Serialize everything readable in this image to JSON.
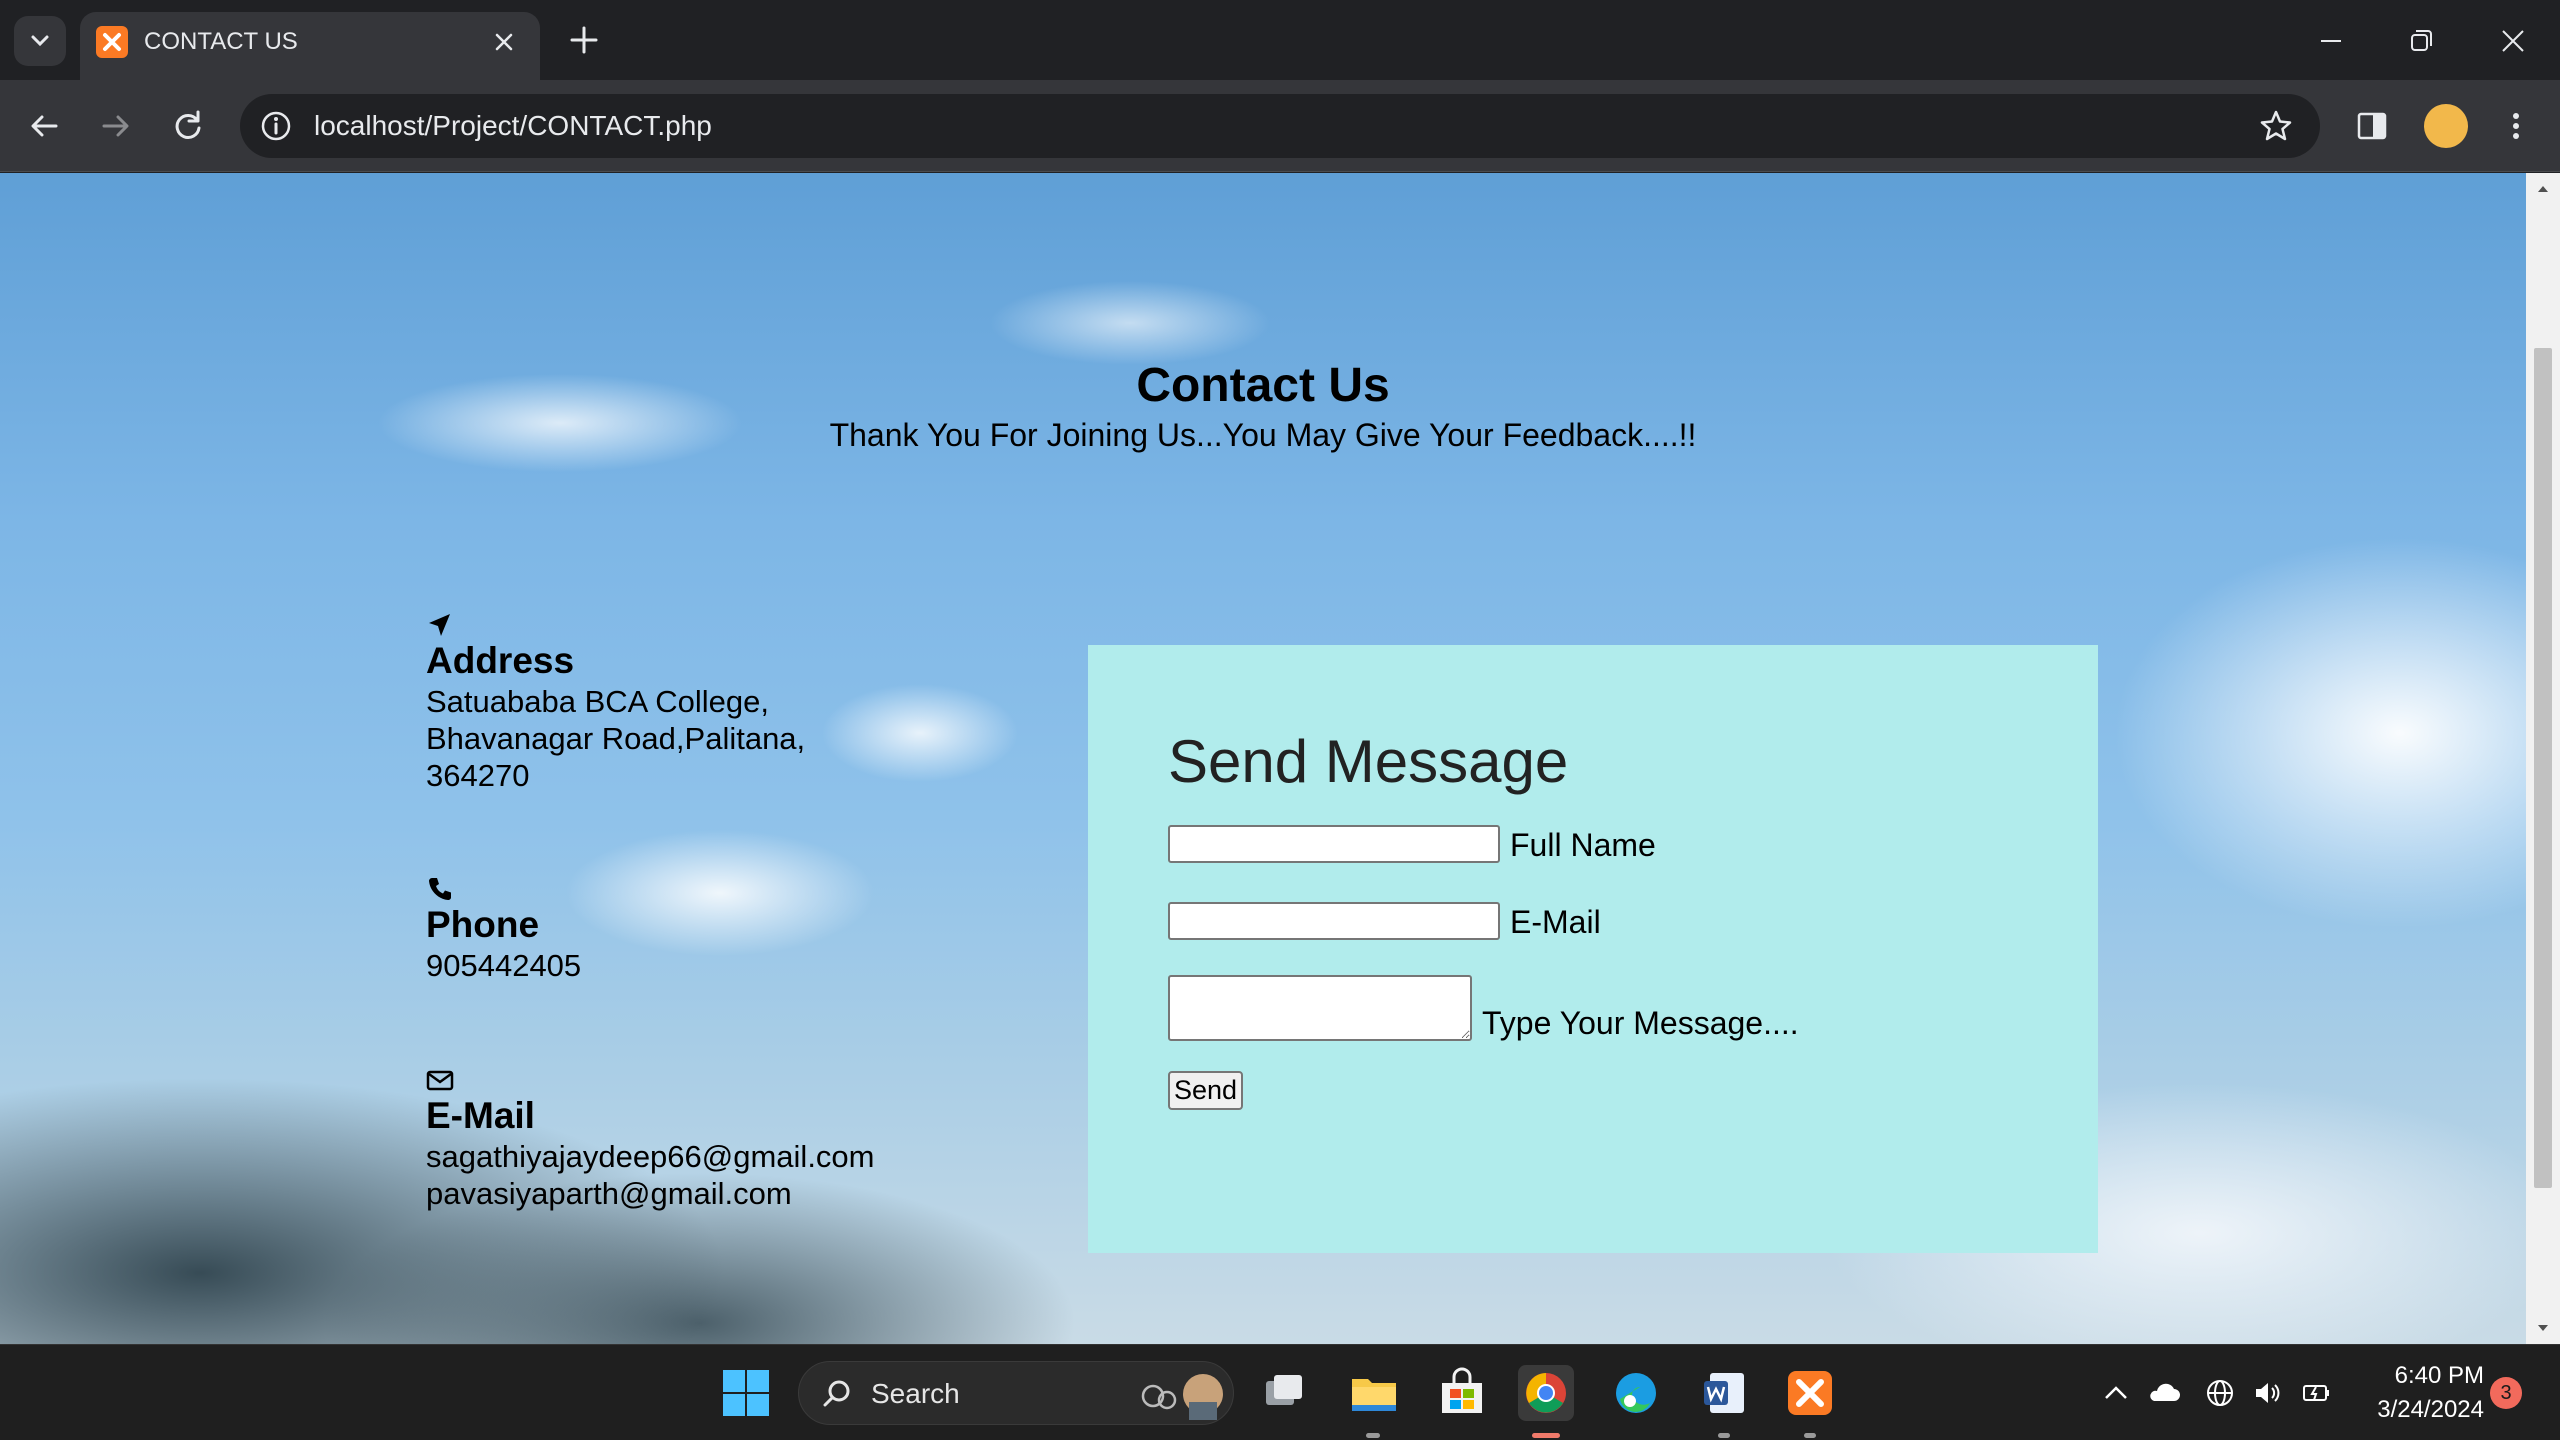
{
  "browser": {
    "tab_title": "CONTACT US",
    "url": "localhost/Project/CONTACT.php"
  },
  "page": {
    "title": "Contact Us",
    "subtitle": "Thank You For Joining Us...You May Give Your Feedback....!!",
    "address": {
      "heading": "Address",
      "lines": [
        "Satuababa BCA College,",
        "Bhavanagar Road,Palitana,",
        "364270"
      ],
      "icon": "location-arrow-icon"
    },
    "phone": {
      "heading": "Phone",
      "value": "905442405",
      "icon": "phone-icon"
    },
    "email": {
      "heading": "E-Mail",
      "lines": [
        "sagathiyajaydeep66@gmail.com",
        "pavasiyaparth@gmail.com"
      ],
      "icon": "envelope-icon"
    },
    "form": {
      "title": "Send Message",
      "full_name_label": "Full Name",
      "full_name_value": "",
      "email_label": "E-Mail",
      "email_value": "",
      "message_label": "Type Your Message....",
      "message_value": "",
      "send_label": "Send",
      "panel_color": "#b1ecec"
    }
  },
  "taskbar": {
    "search_label": "Search",
    "time": "6:40 PM",
    "date": "3/24/2024",
    "notification_count": "3"
  }
}
